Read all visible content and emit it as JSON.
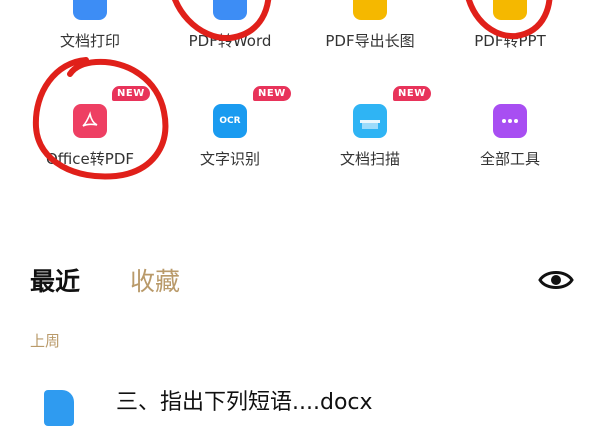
{
  "tools_row_top": [
    {
      "label": "文档打印",
      "icon": "print-icon",
      "color": "#3d8df5"
    },
    {
      "label": "PDF转Word",
      "icon": "pdf-to-word-icon",
      "color": "#3d8df5"
    },
    {
      "label": "PDF导出长图",
      "icon": "pdf-export-image-icon",
      "color": "#f5b800"
    },
    {
      "label": "PDF转PPT",
      "icon": "pdf-to-ppt-icon",
      "color": "#f5b800"
    }
  ],
  "tools_row_main": [
    {
      "label": "Office转PDF",
      "icon": "office-to-pdf-icon",
      "color": "#ee3f63",
      "badge": "NEW"
    },
    {
      "label": "文字识别",
      "icon": "ocr-icon",
      "color": "#1a9bf0",
      "badge": "NEW",
      "icon_text": "OCR"
    },
    {
      "label": "文档扫描",
      "icon": "scan-icon",
      "color": "#2fb4f4",
      "badge": "NEW"
    },
    {
      "label": "全部工具",
      "icon": "all-tools-icon",
      "color": "#a84ef2"
    }
  ],
  "tabs": {
    "recent": "最近",
    "favorites": "收藏"
  },
  "section_last_week": "上周",
  "recent_file": {
    "name": "三、指出下列短语....docx",
    "icon": "docx-file-icon",
    "color": "#2f9bf0"
  },
  "colors": {
    "accent_gold": "#b99a6a",
    "annotation_red": "#e0201a",
    "badge_red": "#e8335a"
  }
}
